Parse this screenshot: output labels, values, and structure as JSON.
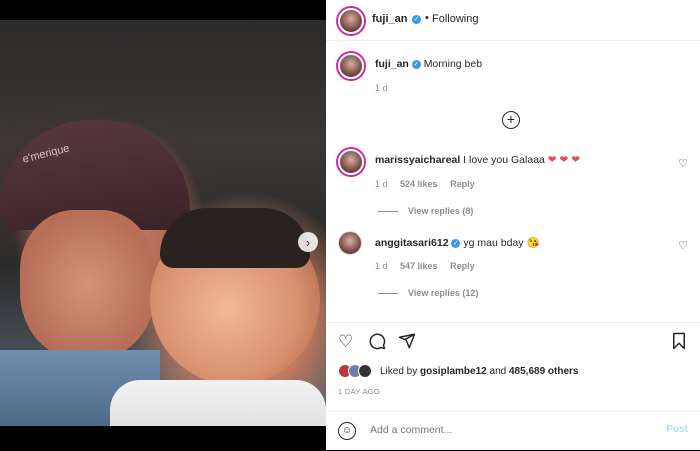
{
  "post": {
    "username": "fuji_an",
    "following": "Following",
    "dot": "•",
    "caption": "Morning beb",
    "caption_age": "1 d",
    "verified_icon": "verified-badge-icon"
  },
  "comments": [
    {
      "user": "marissyaichareal",
      "text": "I love you Galaaa",
      "emoji": "❤ ❤ ❤",
      "age": "1 d",
      "likes": "524 likes",
      "reply": "Reply",
      "replies": "View replies (8)"
    },
    {
      "user": "anggitasari612",
      "text": "yg mau bday",
      "emoji": "😘",
      "age": "1 d",
      "likes": "547 likes",
      "reply": "Reply",
      "replies": "View replies (12)"
    }
  ],
  "actions": {
    "like_icon": "heart-icon",
    "comment_icon": "comment-icon",
    "share_icon": "share-icon",
    "save_icon": "bookmark-icon"
  },
  "liked": {
    "prefix": "Liked by",
    "user": "gosiplambe12",
    "middle": "and",
    "count": "485,689 others"
  },
  "date": "1 DAY AGO",
  "add_comment": {
    "placeholder": "Add a comment...",
    "post_label": "Post"
  },
  "photo": {
    "hat_text": "e'merique"
  },
  "colors": {
    "accent": "#3897f0",
    "heart_red": "#ed4956",
    "post_disabled": "#b2dffc"
  }
}
